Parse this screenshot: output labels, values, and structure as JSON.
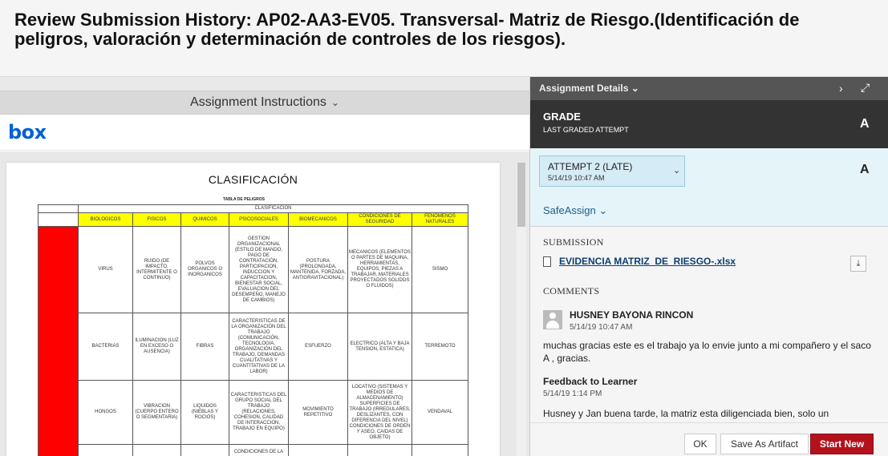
{
  "header": {
    "title": "Review Submission History: AP02-AA3-EV05. Transversal- Matriz de Riesgo.(Identificación de peligros, valoración y determinación de controles de los riesgos)."
  },
  "left": {
    "instructions_label": "Assignment Instructions",
    "box_logo": "box",
    "document": {
      "page_title": "CLASIFICACIÓN",
      "table_title": "TABLA DE PELIGROS",
      "classification_header": "CLASIFICACION",
      "columns": [
        "BIOLOGICOS",
        "FISICOS",
        "QUIMICOS",
        "PSICOSOCIALES",
        "BIOMECANICOS",
        "CONDICIONES DE SEGURIDAD",
        "FENOMENOS NATURALES"
      ],
      "rows": [
        [
          "VIRUS",
          "RUIDO (DE IMPACTO, INTERMITENTE O CONTINUO)",
          "POLVOS ORGANICOS O INORGANICOS",
          "GESTION ORGANIZACIONAL (ESTILO DE MANDO, PAGO DE CONTRATACIÓN, PARTICIPACION, INDUCCION Y CAPACITACION, BIENESTAR SOCIAL, EVALUACION DEL DESEMPEÑO, MANEJO DE CAMBIOS)",
          "POSTURA (PROLONGADA, MANTENIDA, FORZADA, ANTIGRAVITACIONAL)",
          "MECANICOS (ELEMENTOS O PARTES DE MAQUINA, HERRAMIENTAS, EQUIPOS, PIEZAS A TRABAJAR, MATERIALES PROYECTADOS SOLIDOS O FLUIDOS)",
          "SISMO"
        ],
        [
          "BACTERIAS",
          "ILUMINACION (LUZ EN EXCESO O AUSENCIA)",
          "FIBRAS",
          "CARACTERISTICAS DE LA ORGANIZACIÓN DEL TRABAJO (COMUNICACIÓN, TECNOLOGIA, ORGANIZACIÓN DEL TRABAJO, DEMANDAS CUALITATIVAS Y CUANTITATIVAS DE LA LABOR)",
          "ESFUERZO",
          "ELECTRICO (ALTA Y BAJA TENSION, ESTATICA)",
          "TERREMOTO"
        ],
        [
          "HONGOS",
          "VIBRACION (CUERPO ENTERO O SEGMENTARIA)",
          "LIQUIDOS (NIEBLAS Y ROCIOS)",
          "CARACTERISTICAS DEL GRUPO SOCIAL DEL TRABAJO (RELACIONES, COHESION, CALIDAD DE INTERACCION, TRABAJO EN EQUIPO)",
          "MOVIMIENTO REPETITIVO",
          "LOCATIVO (SISTEMAS Y MEDIOS DE ALMACENAMIENTO) SUPERFICIES DE TRABAJO (IRREGULARES, DESLIZANTES, CON DIFERENCIA DEL NIVEL) CONDICIONES DE ORDEN Y ASEO, CAIDAS DE OBJETO)",
          "VENDAVAL"
        ],
        [
          "",
          "",
          "",
          "CONDICIONES DE LA",
          "",
          "",
          ""
        ]
      ]
    }
  },
  "right": {
    "details_label": "Assignment Details",
    "grade_label": "GRADE",
    "grade_sub": "LAST GRADED ATTEMPT",
    "grade_value": "A",
    "attempt_label": "ATTEMPT 2 (LATE)",
    "attempt_date": "5/14/19 10:47 AM",
    "attempt_value": "A",
    "safeassign": "SafeAssign",
    "submission_label": "SUBMISSION",
    "file_name": "EVIDENCIA MATRIZ_DE_RIESGO-.xlsx",
    "comments_label": "COMMENTS",
    "comment_author": "HUSNEY BAYONA RINCON",
    "comment_date": "5/14/19 10:47 AM",
    "comment_text": "muchas gracias este es el trabajo ya lo envie junto a mi compañero y el saco A , gracias.",
    "feedback_label": "Feedback to Learner",
    "feedback_date": "5/14/19 1:14 PM",
    "feedback_text": "Husney  y Jan buena tarde, la matriz esta diligenciada bien, solo un"
  },
  "footer": {
    "ok": "OK",
    "save_artifact": "Save As Artifact",
    "start_new": "Start New"
  },
  "colors": {
    "accent_red": "#b3121d",
    "header_dark": "#333333",
    "link": "#0b3f72",
    "highlight_yellow": "#ffff00"
  },
  "icons": [
    "chevron-down-icon",
    "chevron-right-icon",
    "expand-icon",
    "file-icon",
    "download-icon",
    "avatar-icon"
  ]
}
